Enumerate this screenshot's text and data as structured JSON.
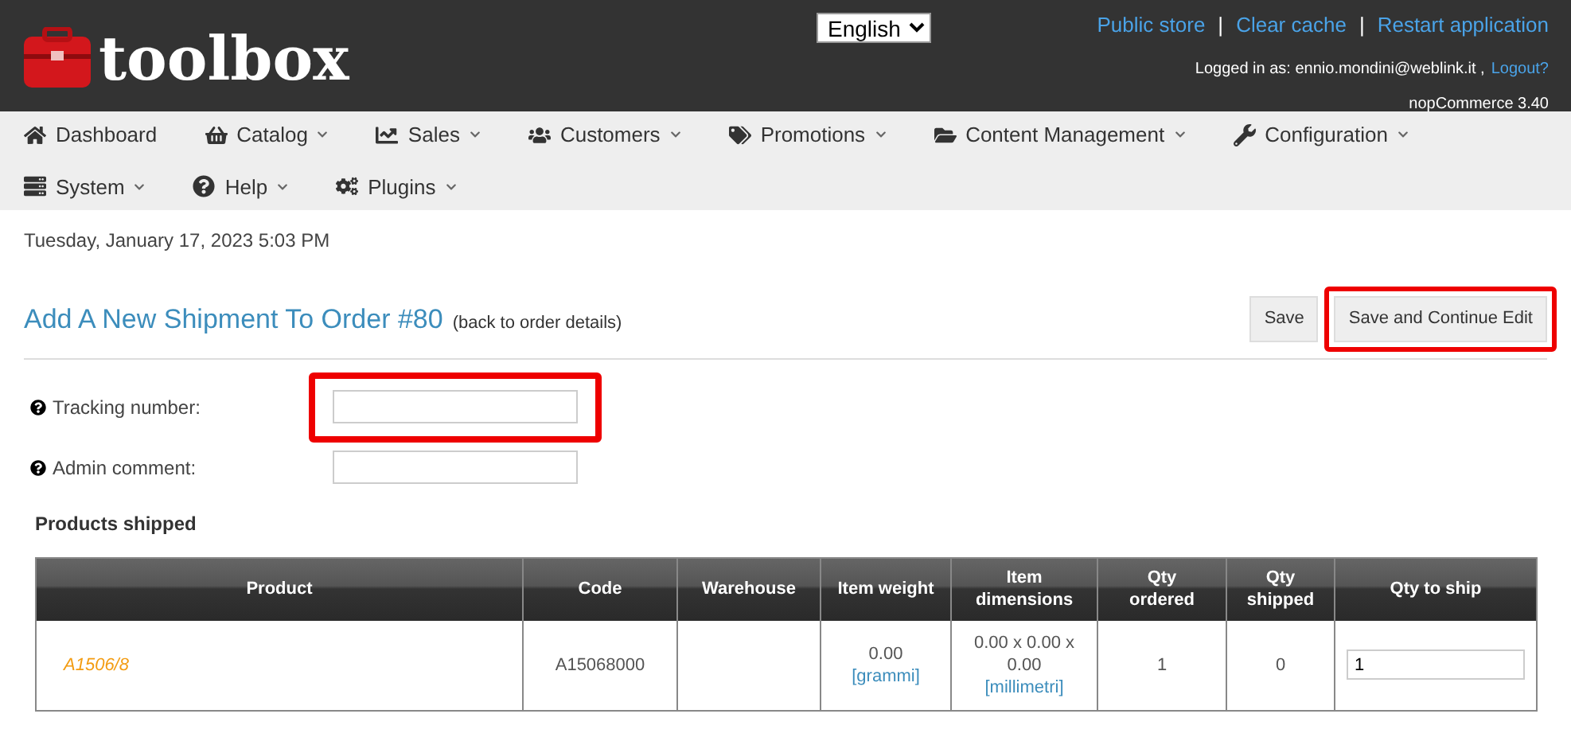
{
  "header": {
    "logo": "toolbox",
    "language": "English",
    "links": [
      "Public store",
      "Clear cache",
      "Restart application"
    ],
    "separator": "|",
    "logged_in": "Logged in as: ennio.mondini@weblink.it ,",
    "logout": "Logout?",
    "version": "nopCommerce 3.40"
  },
  "menu": [
    {
      "label": "Dashboard",
      "kind": "home",
      "dropdown": false
    },
    {
      "label": "Catalog",
      "kind": "basket",
      "dropdown": true
    },
    {
      "label": "Sales",
      "kind": "chart",
      "dropdown": true
    },
    {
      "label": "Customers",
      "kind": "users",
      "dropdown": true
    },
    {
      "label": "Promotions",
      "kind": "tags",
      "dropdown": true
    },
    {
      "label": "Content Management",
      "kind": "folder",
      "dropdown": true
    },
    {
      "label": "Configuration",
      "kind": "wrench",
      "dropdown": true
    },
    {
      "label": "System",
      "kind": "server",
      "dropdown": true
    },
    {
      "label": "Help",
      "kind": "help",
      "dropdown": true
    },
    {
      "label": "Plugins",
      "kind": "cogs",
      "dropdown": true
    }
  ],
  "date": "Tuesday, January 17, 2023 5:03 PM",
  "page": {
    "title": "Add A New Shipment To Order #80",
    "back_link": "(back to order details)",
    "buttons": [
      {
        "label": "Save",
        "highlighted": false
      },
      {
        "label": "Save and Continue Edit",
        "highlighted": true
      }
    ]
  },
  "fields": [
    {
      "label": "Tracking number:",
      "highlighted": true
    },
    {
      "label": "Admin comment:",
      "highlighted": false
    }
  ],
  "section": "Products shipped",
  "table": {
    "columns": [
      "Product",
      "Code",
      "Warehouse",
      "Item weight",
      "Item dimensions",
      "Qty ordered",
      "Qty shipped",
      "Qty to ship"
    ],
    "rows": [
      {
        "product": "A1506/8",
        "code": "A15068000",
        "weight": "0.00",
        "weight_unit": "[grammi]",
        "dimensions": "0.00 x 0.00 x 0.00",
        "dimensions_unit": "[millimetri]",
        "qty_ordered": "1",
        "qty_shipped": "0",
        "qty_to_ship": "1"
      }
    ]
  }
}
